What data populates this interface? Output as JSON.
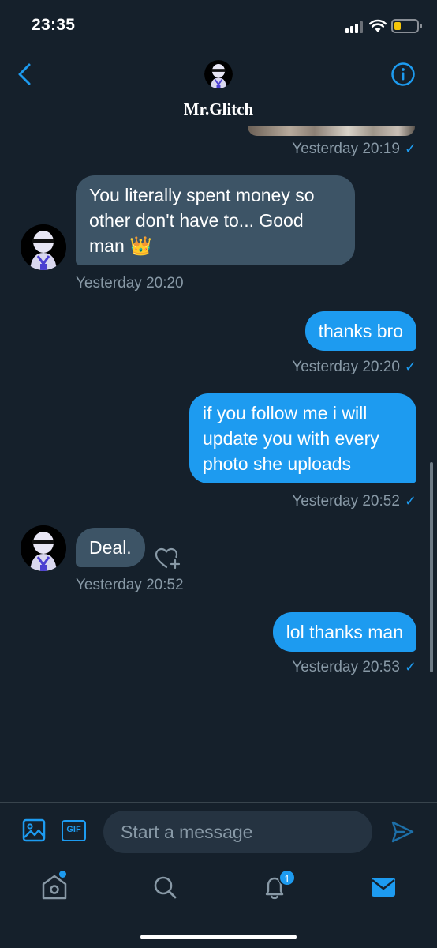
{
  "status_bar": {
    "time": "23:35"
  },
  "header": {
    "contact_name": "Mr.Glitch"
  },
  "messages": [
    {
      "sender": "other",
      "text": "You literally spent money so other don't have to... Good man 👑",
      "timestamp": "Yesterday 20:20"
    },
    {
      "sender": "me",
      "text": "thanks bro",
      "timestamp": "Yesterday 20:20"
    },
    {
      "sender": "me",
      "text": "if you follow me i will update you with every photo she uploads",
      "timestamp": "Yesterday 20:52"
    },
    {
      "sender": "other",
      "text": "Deal.",
      "timestamp": "Yesterday 20:52"
    },
    {
      "sender": "me",
      "text": "lol thanks man",
      "timestamp": "Yesterday 20:53"
    }
  ],
  "previous_message": {
    "timestamp": "Yesterday 20:19"
  },
  "read_check": "✓",
  "composer": {
    "placeholder": "Start a message",
    "gif_label": "GIF"
  },
  "tabbar": {
    "notifications_badge": "1"
  },
  "colors": {
    "background": "#15202b",
    "accent": "#1d9bf0",
    "received_bubble": "#3d5466",
    "secondary_text": "#8899a6"
  },
  "icons": [
    "back-arrow-icon",
    "info-icon",
    "image-icon",
    "gif-icon",
    "send-icon",
    "home-icon",
    "search-icon",
    "bell-icon",
    "mail-icon",
    "heart-add-icon"
  ]
}
